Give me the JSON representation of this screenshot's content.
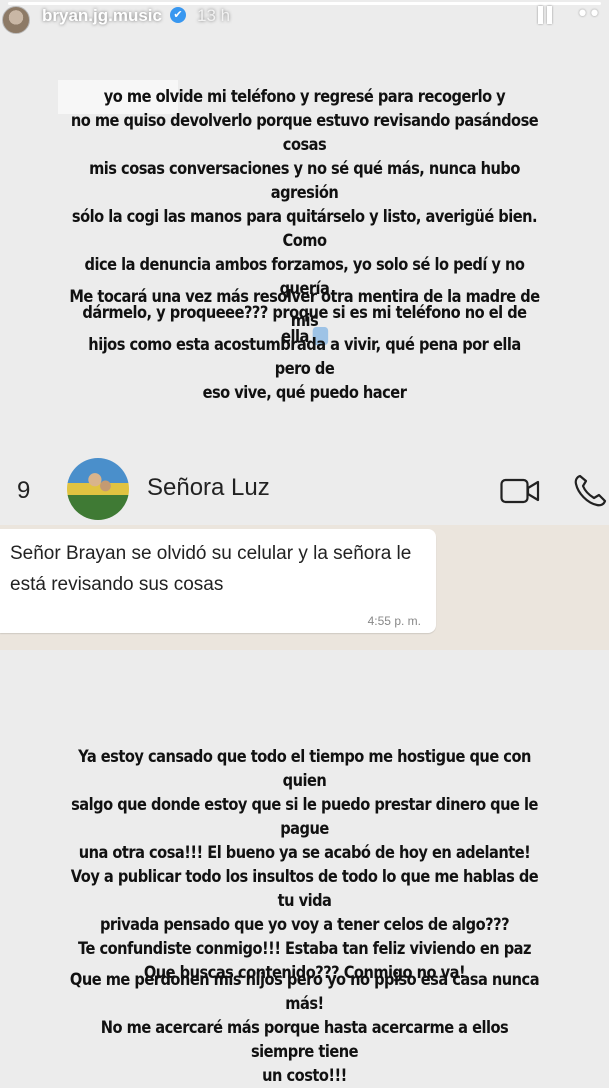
{
  "header": {
    "username": "bryan.jg.music",
    "time_ago": "13 h",
    "verified_glyph": "✔",
    "more_glyph": "••",
    "progress": 1.0,
    "icons": [
      "pause-icon",
      "more-icon",
      "verified-icon"
    ]
  },
  "story": {
    "block1": "yo me olvide mi teléfono y regresé para recogerlo y\nno me quiso devolverlo porque estuvo revisando pasándose cosas\nmis cosas conversaciones y no sé qué más, nunca hubo agresión\nsólo la cogi las manos para quitárselo y listo, averigüé bien.  Como\ndice la denuncia ambos forzamos, yo solo sé lo pedí y no quería\ndármelo, y proqueee???  proque si es mi teléfono no el de ella",
    "block2": "Me tocará una vez más resolver otra mentira de la madre de mis\nhijos como  esta acostumbrada a vivir, qué pena por ella pero de\neso vive, qué puedo hacer",
    "block3": "Ya estoy cansado que todo el tiempo me hostigue que con quien\nsalgo que donde estoy que si le puedo prestar dinero que le pague\nuna otra cosa!!!  El bueno ya se acabó de hoy en adelante!\nVoy a publicar todo los insultos de todo lo que me hablas de tu vida\nprivada pensado que yo voy a tener celos de algo???\nTe confundiste conmigo!!!  Estaba tan feliz viviendo en paz\nQue buscas contenido??? Conmigo no va!",
    "block4": "Que me perdonen mis hijos pero yo no ppiso esa casa nunca más!\nNo me acercaré más porque hasta acercarme a ellos siempre tiene\nun costo!!!"
  },
  "whatsapp": {
    "back_count": "9",
    "contact_name": "Señora Luz",
    "message": "Señor Brayan se olvidó su celular y la señora le está revisando sus cosas",
    "time": "4:55 p. m.",
    "icons": [
      "video-call-icon",
      "phone-call-icon",
      "contact-avatar"
    ]
  },
  "colors": {
    "background": "#ececec",
    "whatsapp_chat_bg": "#ebe5dd",
    "bubble": "#ffffff",
    "verified_blue": "#3897f0"
  }
}
